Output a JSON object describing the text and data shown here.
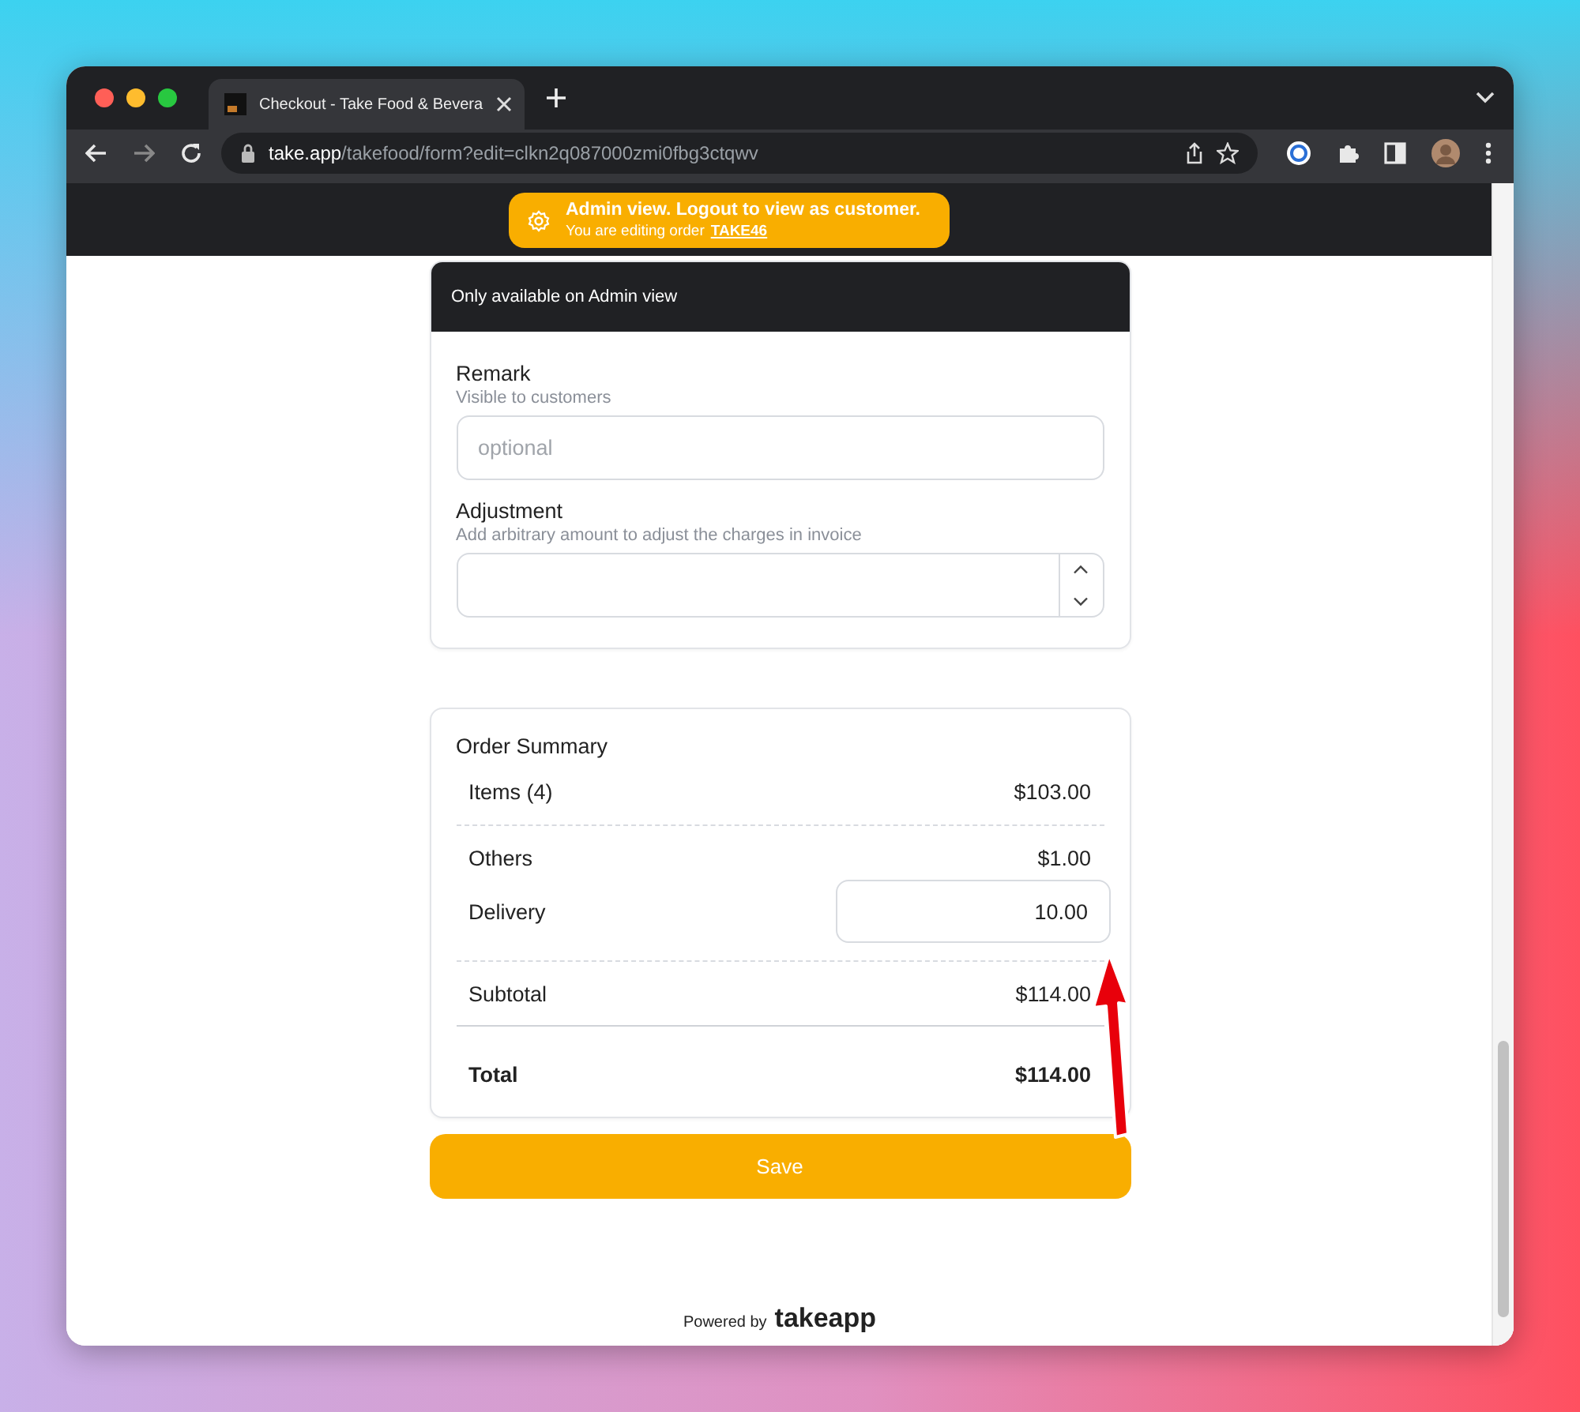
{
  "browser": {
    "tab_title": "Checkout - Take Food & Bevera",
    "url_host": "take.app",
    "url_path": "/takefood/form?edit=clkn2q087000zmi0fbg3ctqwv"
  },
  "banner": {
    "title": "Admin view. Logout to view as customer.",
    "subtitle": "You are editing order",
    "order_link": "TAKE46"
  },
  "admin_card": {
    "header": "Only available on Admin view",
    "fields": [
      {
        "kind": "text",
        "label": "Remark",
        "hint": "Visible to customers",
        "placeholder": "optional"
      },
      {
        "kind": "number",
        "label": "Adjustment",
        "hint": "Add arbitrary amount to adjust the charges in invoice"
      }
    ]
  },
  "order_summary": {
    "title": "Order Summary",
    "sections": [
      [
        {
          "kind": "amount",
          "label": "Items (4)",
          "value": "$103.00"
        }
      ],
      [
        {
          "kind": "amount",
          "label": "Others",
          "value": "$1.00"
        },
        {
          "kind": "input",
          "label": "Delivery",
          "value": "10.00"
        }
      ],
      [
        {
          "kind": "amount",
          "label": "Subtotal",
          "value": "$114.00"
        }
      ],
      [
        {
          "kind": "total",
          "label": "Total",
          "value": "$114.00"
        }
      ]
    ]
  },
  "save_button": "Save",
  "footer": {
    "powered_by": "Powered by",
    "brand": "takeapp"
  },
  "annotation": {
    "kind": "arrow"
  }
}
